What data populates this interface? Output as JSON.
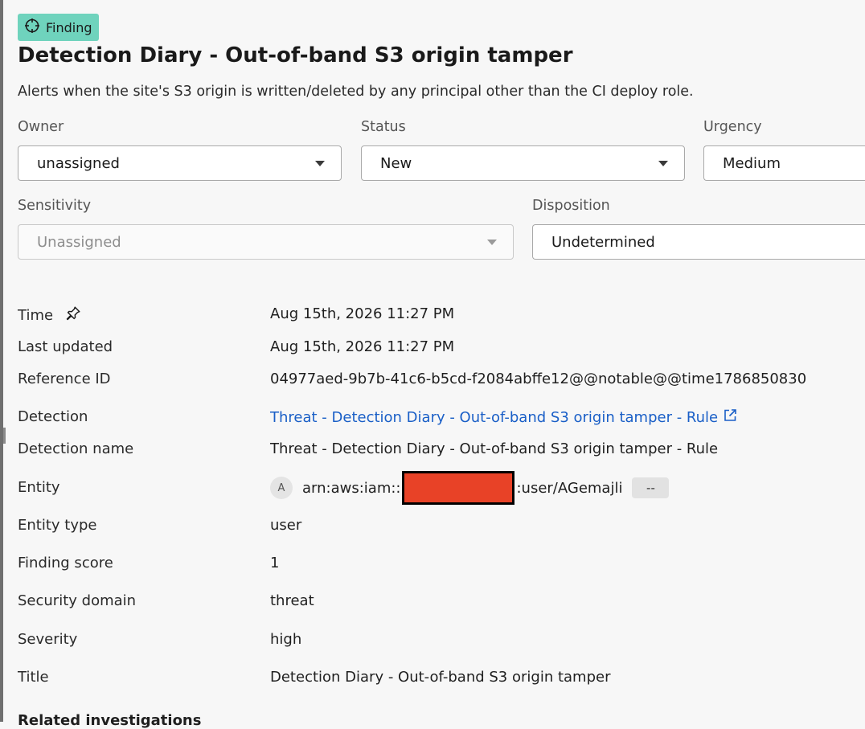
{
  "badge": {
    "label": "Finding",
    "icon": "target-icon"
  },
  "title": "Detection Diary - Out-of-band S3 origin tamper",
  "description": "Alerts when the site's S3 origin is written/deleted by any principal other than the CI deploy role.",
  "fields": {
    "owner": {
      "label": "Owner",
      "value": "unassigned"
    },
    "status": {
      "label": "Status",
      "value": "New"
    },
    "urgency": {
      "label": "Urgency",
      "value": "Medium"
    },
    "sensitivity": {
      "label": "Sensitivity",
      "value": "Unassigned"
    },
    "disposition": {
      "label": "Disposition",
      "value": "Undetermined"
    }
  },
  "details": {
    "time": {
      "label": "Time",
      "value": "Aug 15th, 2026 11:27 PM"
    },
    "last_updated": {
      "label": "Last updated",
      "value": "Aug 15th, 2026 11:27 PM"
    },
    "reference_id": {
      "label": "Reference ID",
      "value": "04977aed-9b7b-41c6-b5cd-f2084abffe12@@notable@@time1786850830"
    },
    "detection": {
      "label": "Detection",
      "value": "Threat - Detection Diary - Out-of-band S3 origin tamper - Rule"
    },
    "detection_name": {
      "label": "Detection name",
      "value": "Threat - Detection Diary - Out-of-band S3 origin tamper - Rule"
    },
    "entity": {
      "label": "Entity",
      "avatar": "A",
      "prefix": "arn:aws:iam::",
      "suffix": ":user/AGemajli",
      "tag": "--"
    },
    "entity_type": {
      "label": "Entity type",
      "value": "user"
    },
    "finding_score": {
      "label": "Finding score",
      "value": "1"
    },
    "security_domain": {
      "label": "Security domain",
      "value": "threat"
    },
    "severity": {
      "label": "Severity",
      "value": "high"
    },
    "title": {
      "label": "Title",
      "value": "Detection Diary - Out-of-band S3 origin tamper"
    }
  },
  "related_section": {
    "label": "Related investigations"
  },
  "colors": {
    "badge_bg": "#6fd3bd",
    "link": "#1a5fc7",
    "redaction": "#e84227"
  }
}
